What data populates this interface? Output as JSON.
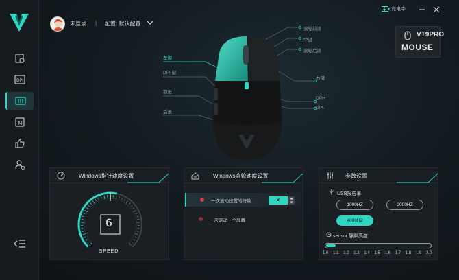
{
  "window": {
    "user_status": "未登录",
    "separator": "|",
    "config_label": "配置: 默认配置",
    "battery_text": "充电中",
    "model_name": "VT9PRO",
    "model_sub": "MOUSE"
  },
  "sidebar": {
    "items": [
      {
        "name": "settings"
      },
      {
        "name": "dpi"
      },
      {
        "name": "keys"
      },
      {
        "name": "macro"
      },
      {
        "name": "like"
      },
      {
        "name": "user"
      }
    ],
    "active_index": 2
  },
  "mouse_labels": {
    "left_key": "左键",
    "dpi_key": "DPI 键",
    "forward": "前进",
    "back": "后退",
    "scroll_up": "滚轮前滚",
    "middle": "中键",
    "scroll_down": "滚轮后滚",
    "right_key": "右键",
    "dpi_plus": "DPI+",
    "dpi_minus": "DPI-"
  },
  "pointer_panel": {
    "title": "Windows指针速度设置",
    "value": "6",
    "value_num": 6,
    "max": 11,
    "caption": "SPEED"
  },
  "scroll_panel": {
    "title": "Windows滚轮速度设置",
    "option1": "一次滚动设置的行数",
    "option2": "一次滚动一个屏幕",
    "lines_value": "3"
  },
  "params_panel": {
    "title": "参数设置",
    "usb_label": "USB报告率",
    "rates": [
      "1000HZ",
      "2000HZ",
      "4000HZ"
    ],
    "selected_rate": "4000HZ",
    "sensor_label": "sensor 静默高度",
    "sensor_ticks": [
      "1.0",
      "1.1",
      "1.2",
      "1.3",
      "1.4",
      "1.5",
      "1.6",
      "1.7",
      "1.8",
      "1.9",
      "2.0"
    ],
    "sensor_value": 1.0
  },
  "colors": {
    "accent": "#2fd6c2",
    "background": "#131b20",
    "panel": "#1a1f23",
    "radio_on": "#d84040"
  }
}
